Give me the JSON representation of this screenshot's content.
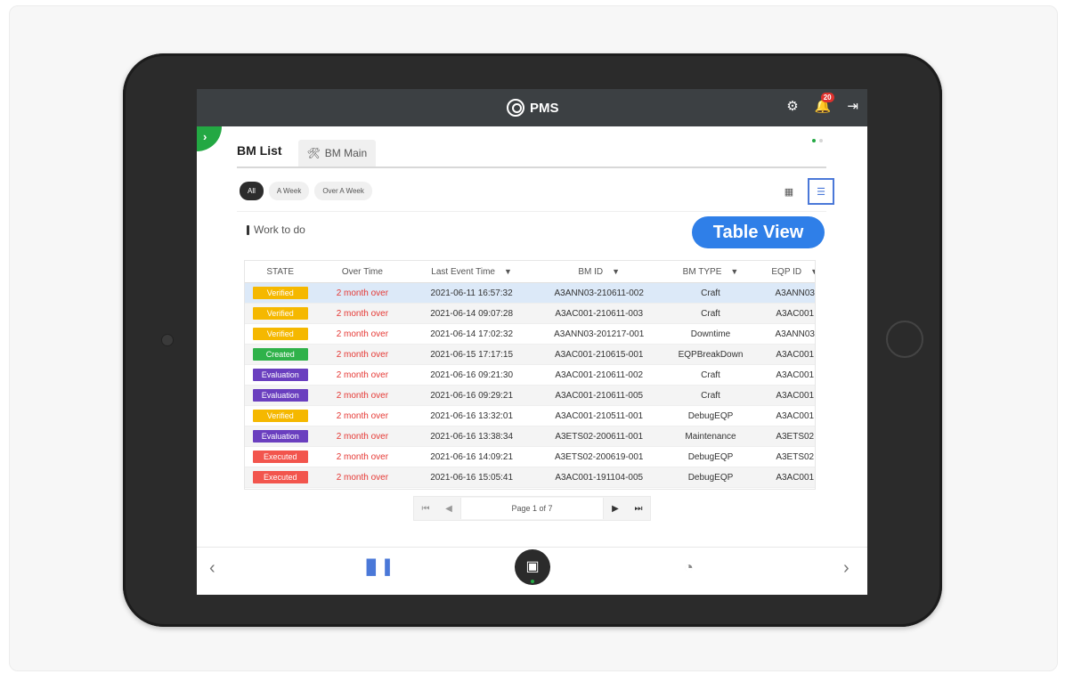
{
  "header": {
    "brand": "PMS",
    "notification_count": "20"
  },
  "tabs": {
    "active": "BM List",
    "secondary": "BM Main"
  },
  "filters": [
    "All",
    "A Week",
    "Over A Week"
  ],
  "section_label": "Work to do",
  "view_badge": "Table View",
  "table": {
    "columns": [
      "STATE",
      "Over Time",
      "Last Event Time",
      "BM ID",
      "BM TYPE",
      "EQP ID"
    ],
    "rows": [
      {
        "state": "Verified",
        "over": "2 month over",
        "time": "2021-06-11 16:57:32",
        "bm_id": "A3ANN03-210611-002",
        "type": "Craft",
        "eqp": "A3ANN03"
      },
      {
        "state": "Verified",
        "over": "2 month over",
        "time": "2021-06-14 09:07:28",
        "bm_id": "A3AC001-210611-003",
        "type": "Craft",
        "eqp": "A3AC001"
      },
      {
        "state": "Verified",
        "over": "2 month over",
        "time": "2021-06-14 17:02:32",
        "bm_id": "A3ANN03-201217-001",
        "type": "Downtime",
        "eqp": "A3ANN03"
      },
      {
        "state": "Created",
        "over": "2 month over",
        "time": "2021-06-15 17:17:15",
        "bm_id": "A3AC001-210615-001",
        "type": "EQPBreakDown",
        "eqp": "A3AC001"
      },
      {
        "state": "Evaluation",
        "over": "2 month over",
        "time": "2021-06-16 09:21:30",
        "bm_id": "A3AC001-210611-002",
        "type": "Craft",
        "eqp": "A3AC001"
      },
      {
        "state": "Evaluation",
        "over": "2 month over",
        "time": "2021-06-16 09:29:21",
        "bm_id": "A3AC001-210611-005",
        "type": "Craft",
        "eqp": "A3AC001"
      },
      {
        "state": "Verified",
        "over": "2 month over",
        "time": "2021-06-16 13:32:01",
        "bm_id": "A3AC001-210511-001",
        "type": "DebugEQP",
        "eqp": "A3AC001"
      },
      {
        "state": "Evaluation",
        "over": "2 month over",
        "time": "2021-06-16 13:38:34",
        "bm_id": "A3ETS02-200611-001",
        "type": "Maintenance",
        "eqp": "A3ETS02"
      },
      {
        "state": "Executed",
        "over": "2 month over",
        "time": "2021-06-16 14:09:21",
        "bm_id": "A3ETS02-200619-001",
        "type": "DebugEQP",
        "eqp": "A3ETS02"
      },
      {
        "state": "Executed",
        "over": "2 month over",
        "time": "2021-06-16 15:05:41",
        "bm_id": "A3AC001-191104-005",
        "type": "DebugEQP",
        "eqp": "A3AC001"
      }
    ]
  },
  "state_colors": {
    "Verified": "#f5b800",
    "Created": "#2fb24a",
    "Evaluation": "#6a3fbf",
    "Executed": "#f2554d"
  },
  "pager": {
    "label": "Page 1 of 7"
  },
  "icons": {
    "settings": "gear-icon",
    "bell": "bell-icon",
    "logout": "logout-icon",
    "grid": "grid-view-icon",
    "list": "list-view-icon",
    "chart": "bar-chart-icon",
    "center": "folder-user-icon",
    "clock": "clock-icon"
  }
}
